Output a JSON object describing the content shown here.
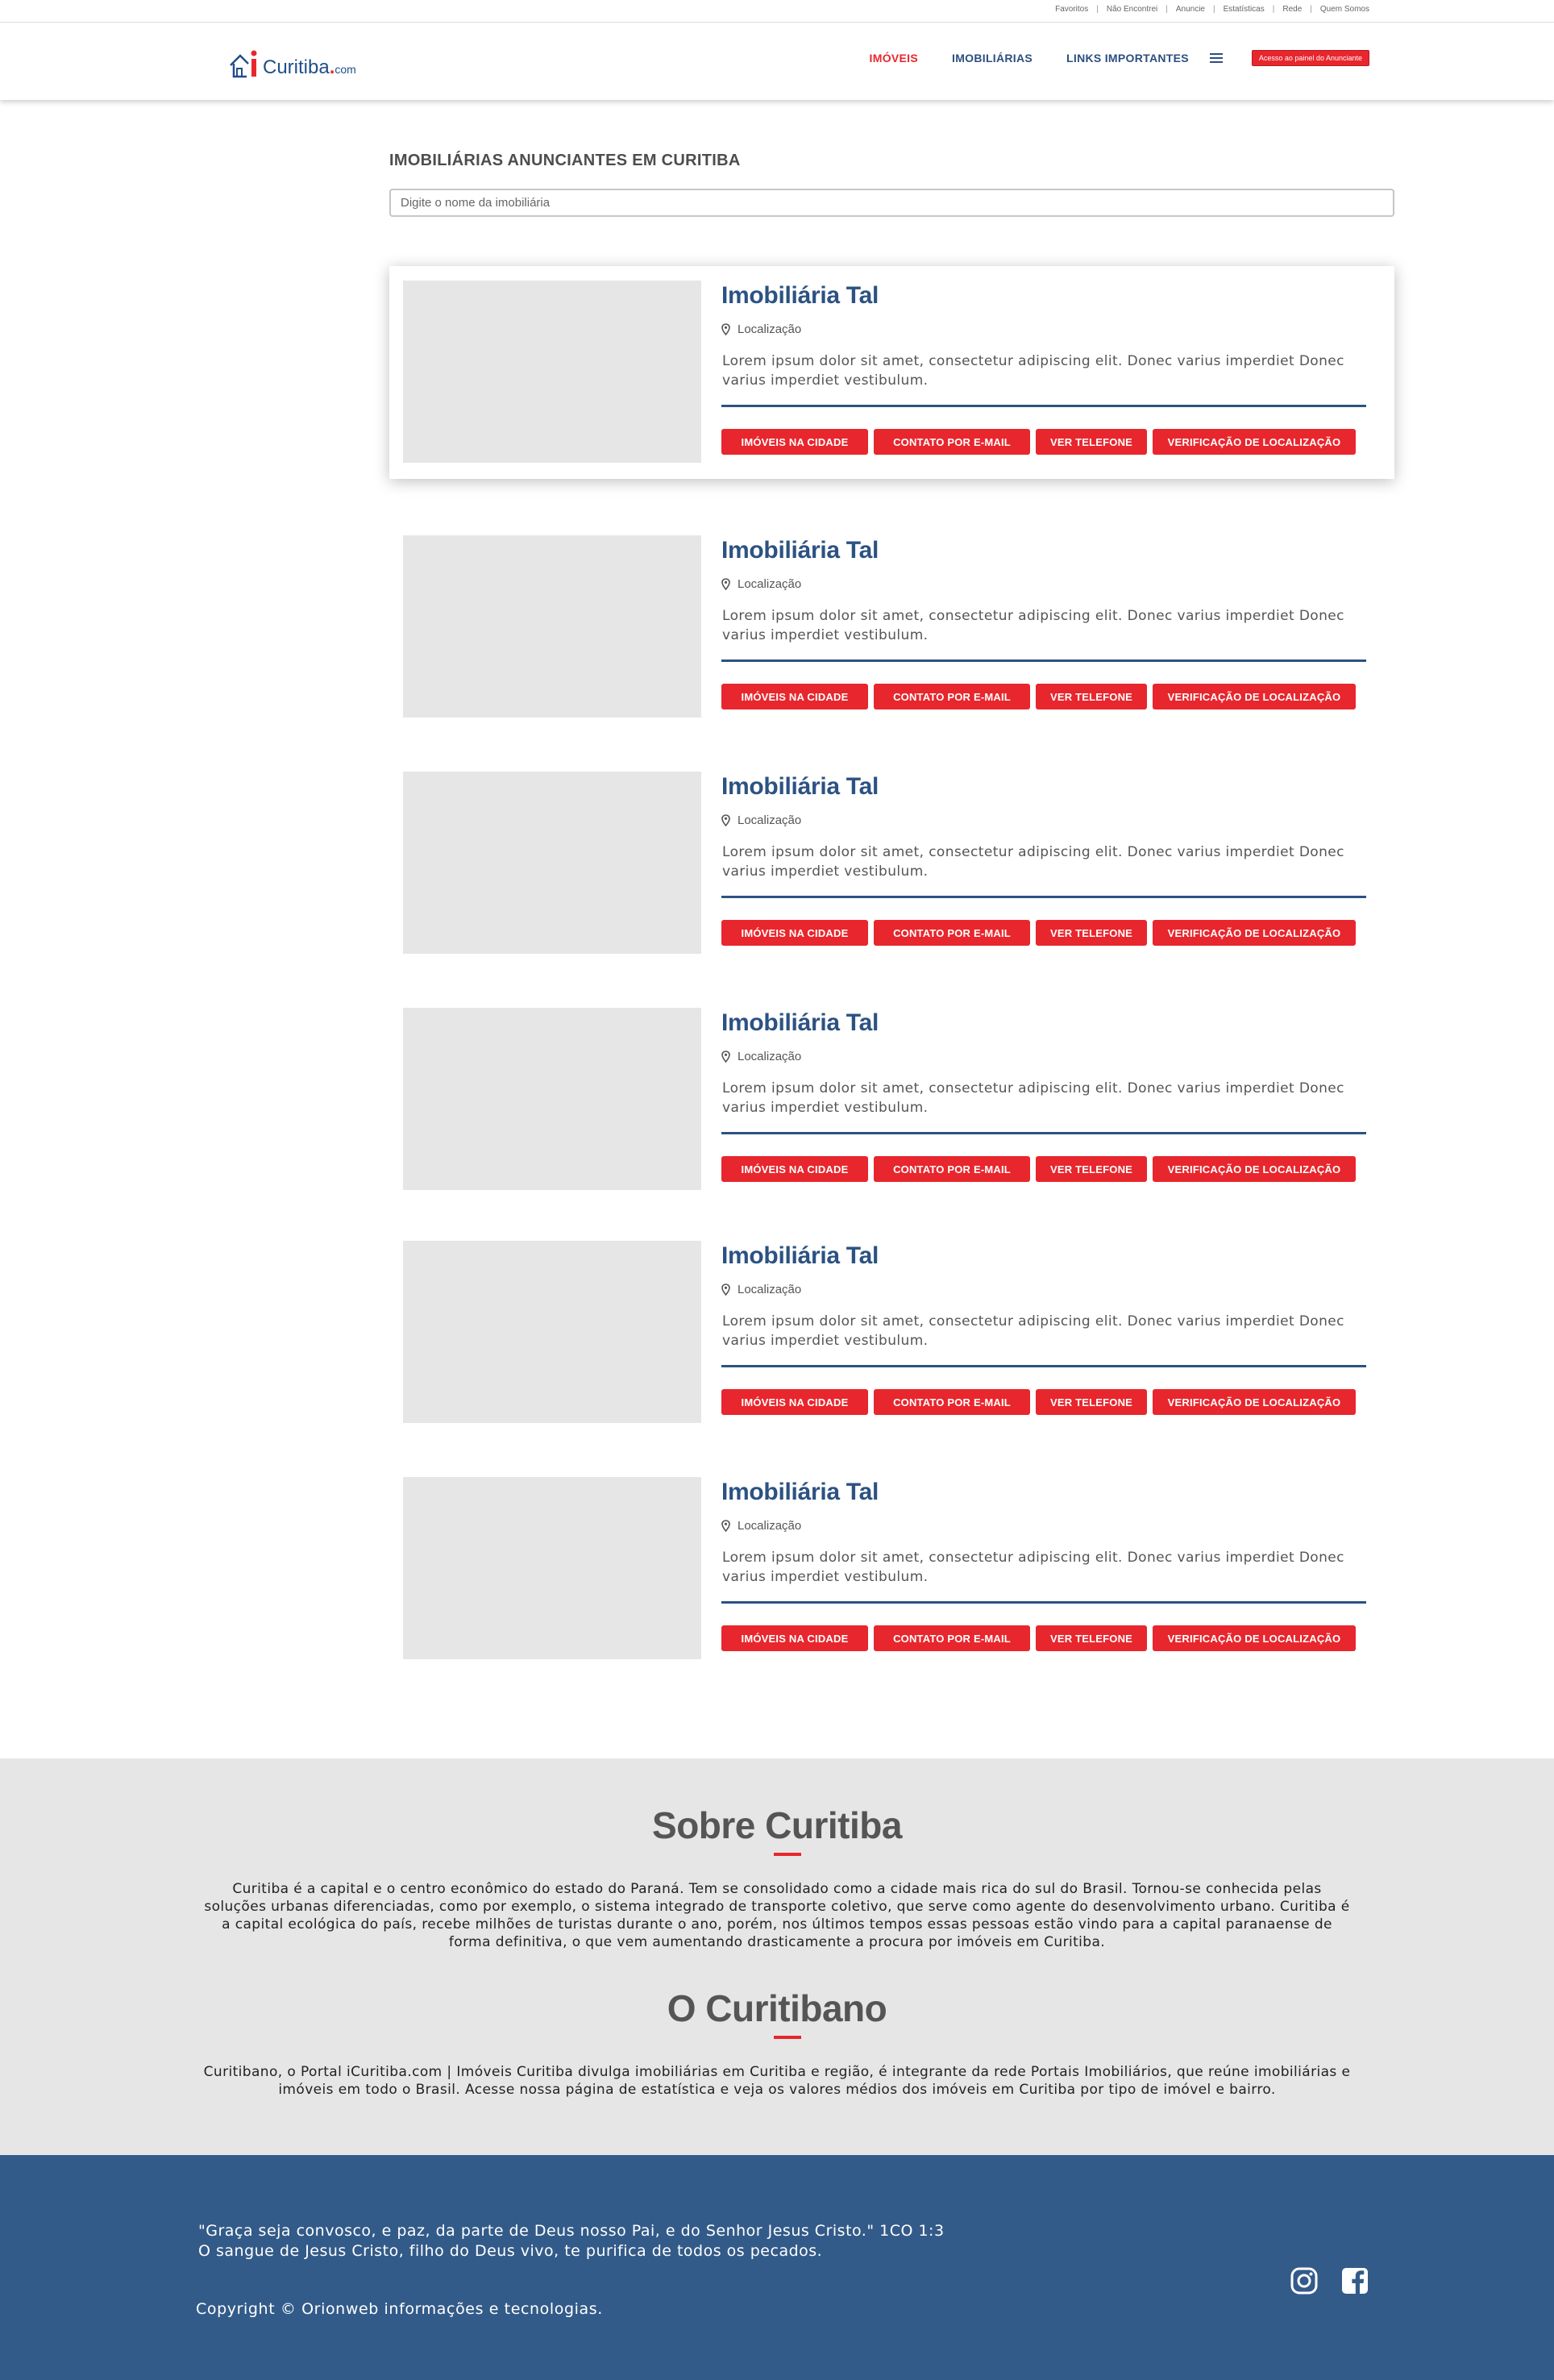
{
  "topbar": {
    "links": [
      "Favoritos",
      "Não Encontrei",
      "Anuncie",
      "Estatísticas",
      "Rede",
      "Quem Somos"
    ]
  },
  "header": {
    "logo": {
      "i": "i",
      "name": "Curitiba",
      "dot": ".",
      "com": "com"
    },
    "nav": {
      "imoveis": "IMÓVEIS",
      "imobiliarias": "IMOBILIÁRIAS",
      "links": "LINKS IMPORTANTES"
    },
    "menu_icon": "hamburger-icon",
    "panel_button": "Acesso ao painel do Anunciante"
  },
  "main": {
    "title": "IMOBILIÁRIAS ANUNCIANTES EM CURITIBA",
    "search_placeholder": "Digite o nome da imobiliária",
    "listings": [
      {
        "name": "Imobiliária Tal",
        "location": "Localização",
        "description": "Lorem ipsum dolor sit amet, consectetur adipiscing elit. Donec varius imperdiet Donec varius imperdiet vestibulum."
      },
      {
        "name": "Imobiliária Tal",
        "location": "Localização",
        "description": "Lorem ipsum dolor sit amet, consectetur adipiscing elit. Donec varius imperdiet Donec varius imperdiet vestibulum."
      },
      {
        "name": "Imobiliária Tal",
        "location": "Localização",
        "description": "Lorem ipsum dolor sit amet, consectetur adipiscing elit. Donec varius imperdiet Donec varius imperdiet vestibulum."
      },
      {
        "name": "Imobiliária Tal",
        "location": "Localização",
        "description": "Lorem ipsum dolor sit amet, consectetur adipiscing elit. Donec varius imperdiet Donec varius imperdiet vestibulum."
      },
      {
        "name": "Imobiliária Tal",
        "location": "Localização",
        "description": "Lorem ipsum dolor sit amet, consectetur adipiscing elit. Donec varius imperdiet Donec varius imperdiet vestibulum."
      },
      {
        "name": "Imobiliária Tal",
        "location": "Localização",
        "description": "Lorem ipsum dolor sit amet, consectetur adipiscing elit. Donec varius imperdiet Donec varius imperdiet vestibulum."
      }
    ],
    "buttons": {
      "imoveis_cidade": "IMÓVEIS NA CIDADE",
      "contato_email": "CONTATO POR E-MAIL",
      "ver_telefone": "VER TELEFONE",
      "verificacao": "VERIFICAÇÃO DE LOCALIZAÇÃO"
    }
  },
  "about": {
    "title1": "Sobre Curitiba",
    "text1": "Curitiba é a capital e o centro econômico do estado do Paraná. Tem se consolidado como a cidade mais rica do sul do Brasil. Tornou-se conhecida pelas soluções urbanas diferenciadas, como por exemplo, o sistema integrado de transporte coletivo, que serve como agente do desenvolvimento urbano. Curitiba é a capital ecológica do país, recebe milhões de turistas durante o ano, porém, nos últimos tempos essas pessoas estão vindo para a capital paranaense de forma definitiva, o que vem aumentando drasticamente a procura por imóveis em Curitiba.",
    "title2": "O Curitibano",
    "text2": "Curitibano, o Portal iCuritiba.com | Imóveis Curitiba divulga imobiliárias em Curitiba e região, é integrante da rede Portais Imobiliários, que reúne imobiliárias e imóveis em todo o Brasil. Acesse nossa página de estatística e veja os valores médios dos imóveis em Curitiba por tipo de imóvel e bairro."
  },
  "footer": {
    "quote_line1": "\"Graça seja convosco, e paz, da parte de Deus nosso Pai, e do Senhor Jesus Cristo.\" 1CO 1:3",
    "quote_line2": "O sangue de Jesus Cristo, filho do Deus vivo, te purifica de todos os pecados.",
    "copyright": "Copyright © Orionweb informações e tecnologias.",
    "social": [
      "instagram-icon",
      "facebook-icon"
    ]
  },
  "colors": {
    "accent": "#e8262d",
    "brand_blue": "#2c5282",
    "footer_blue": "#335b89",
    "section_gray": "#e6e6e6"
  }
}
